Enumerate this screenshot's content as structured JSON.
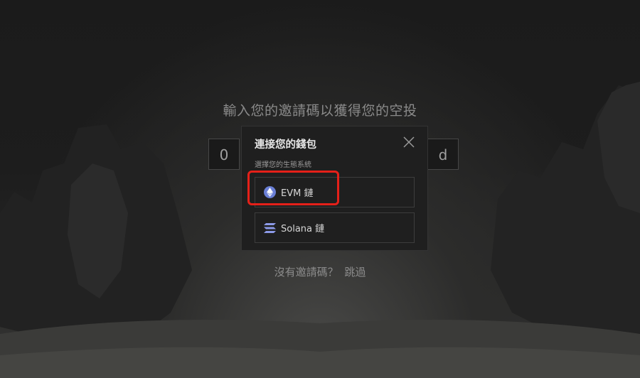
{
  "airdrop": {
    "headline": "輸入您的邀請碼以獲得您的空投",
    "code_first_char": "0",
    "code_last_char": "d",
    "no_code_text": "沒有邀請碼？",
    "skip_label": "跳過"
  },
  "wallet_modal": {
    "title": "連接您的錢包",
    "subtitle": "選擇您的生態系統",
    "close_icon": "close-icon",
    "options": [
      {
        "label": "EVM 鏈",
        "icon": "ethereum-icon",
        "highlighted": true
      },
      {
        "label": "Solana 鏈",
        "icon": "solana-icon",
        "highlighted": false
      }
    ]
  },
  "colors": {
    "background": "#1c1c1c",
    "modal_bg": "#1f1f1f",
    "highlight": "#e52019",
    "ethereum": "#6a7fd6",
    "solana": "#8c9ae8"
  }
}
